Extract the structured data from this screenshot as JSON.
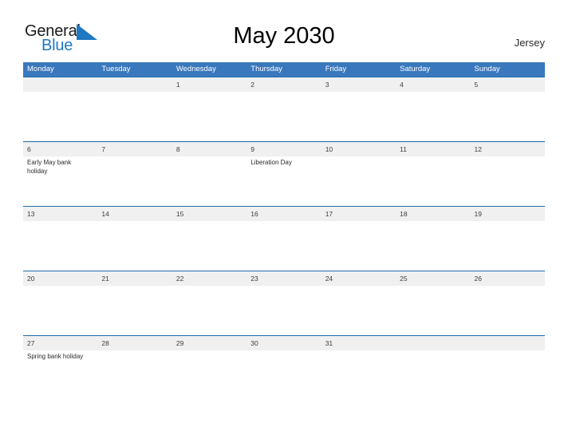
{
  "logo": {
    "word_one": "General",
    "word_two": "Blue",
    "flag_icon": "blue-triangle-flag-icon",
    "brand_blue": "#1f78c1",
    "text_dark": "#1a1a1a"
  },
  "header": {
    "title": "May 2030",
    "location": "Jersey"
  },
  "colors": {
    "weekday_header_bg": "#3a78bd",
    "weekday_header_text": "#ffffff",
    "number_band_bg": "#f0f0f0",
    "row_rule": "#1f6cb0",
    "number_text": "#3d3d3d",
    "event_text": "#2b2b2b",
    "page_bg": "#ffffff"
  },
  "calendar": {
    "month": "May",
    "year": "2030",
    "weekday_headers": [
      "Monday",
      "Tuesday",
      "Wednesday",
      "Thursday",
      "Friday",
      "Saturday",
      "Sunday"
    ],
    "weeks": [
      {
        "days": [
          {
            "number": "",
            "event": ""
          },
          {
            "number": "",
            "event": ""
          },
          {
            "number": "1",
            "event": ""
          },
          {
            "number": "2",
            "event": ""
          },
          {
            "number": "3",
            "event": ""
          },
          {
            "number": "4",
            "event": ""
          },
          {
            "number": "5",
            "event": ""
          }
        ]
      },
      {
        "days": [
          {
            "number": "6",
            "event": "Early May bank holiday"
          },
          {
            "number": "7",
            "event": ""
          },
          {
            "number": "8",
            "event": ""
          },
          {
            "number": "9",
            "event": "Liberation Day"
          },
          {
            "number": "10",
            "event": ""
          },
          {
            "number": "11",
            "event": ""
          },
          {
            "number": "12",
            "event": ""
          }
        ]
      },
      {
        "days": [
          {
            "number": "13",
            "event": ""
          },
          {
            "number": "14",
            "event": ""
          },
          {
            "number": "15",
            "event": ""
          },
          {
            "number": "16",
            "event": ""
          },
          {
            "number": "17",
            "event": ""
          },
          {
            "number": "18",
            "event": ""
          },
          {
            "number": "19",
            "event": ""
          }
        ]
      },
      {
        "days": [
          {
            "number": "20",
            "event": ""
          },
          {
            "number": "21",
            "event": ""
          },
          {
            "number": "22",
            "event": ""
          },
          {
            "number": "23",
            "event": ""
          },
          {
            "number": "24",
            "event": ""
          },
          {
            "number": "25",
            "event": ""
          },
          {
            "number": "26",
            "event": ""
          }
        ]
      },
      {
        "days": [
          {
            "number": "27",
            "event": "Spring bank holiday"
          },
          {
            "number": "28",
            "event": ""
          },
          {
            "number": "29",
            "event": ""
          },
          {
            "number": "30",
            "event": ""
          },
          {
            "number": "31",
            "event": ""
          },
          {
            "number": "",
            "event": ""
          },
          {
            "number": "",
            "event": ""
          }
        ]
      }
    ]
  }
}
